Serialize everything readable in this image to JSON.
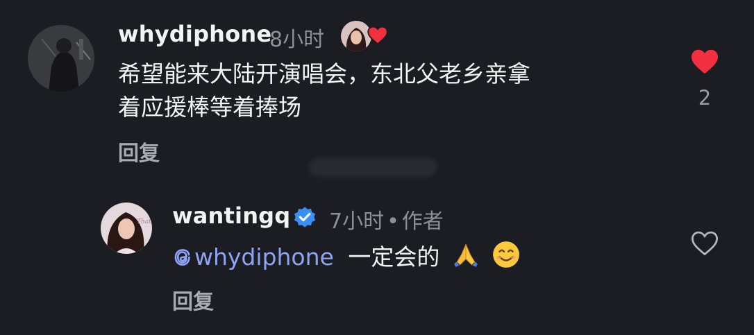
{
  "comments": [
    {
      "username": "whydiphone",
      "time": "8小时",
      "text_line1": "希望能来大陆开演唱会，东北父老乡亲拿",
      "text_line2": "着应援棒等着捧场",
      "reply_label": "回复",
      "like_count": "2",
      "liked": true,
      "author_liked": true
    },
    {
      "username": "wantingq",
      "verified": true,
      "time": "7小时",
      "author_tag": "作者",
      "mention": "whydiphone",
      "text": "一定会的",
      "emojis": [
        "folded-hands",
        "smiling-face"
      ],
      "reply_label": "回复",
      "liked": false
    }
  ],
  "colors": {
    "background": "#1b1d22",
    "like_red": "#f3303f",
    "verified_blue": "#3a8ff6",
    "mention_blue": "#8fa3f5"
  }
}
